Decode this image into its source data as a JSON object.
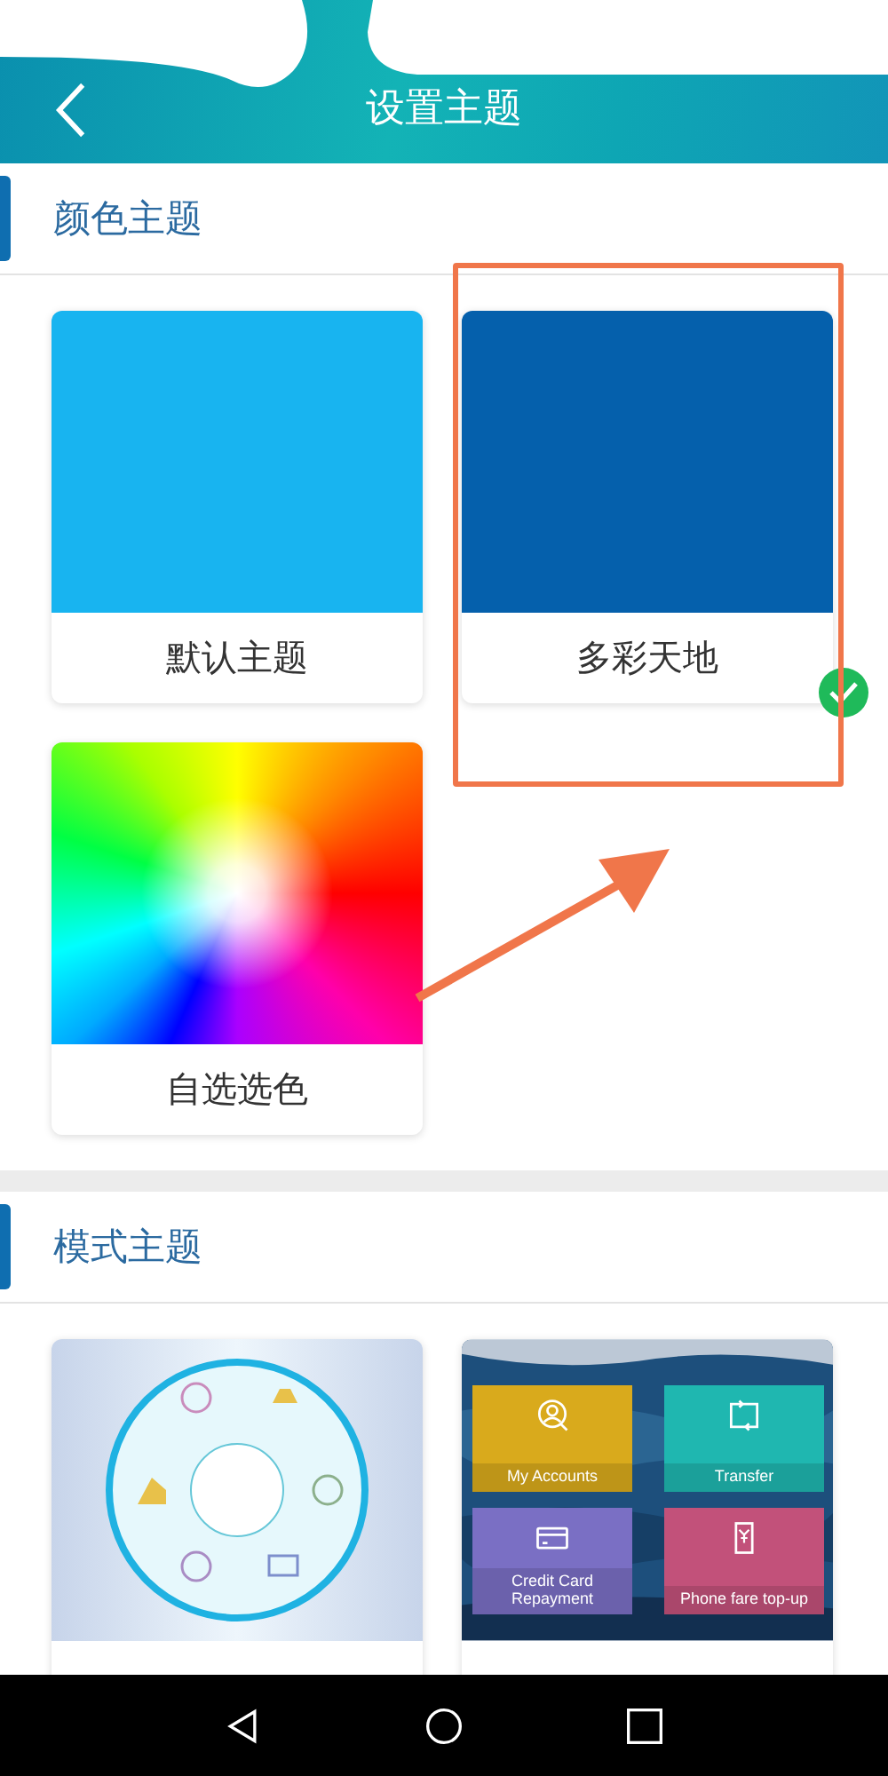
{
  "header": {
    "title": "设置主题"
  },
  "color_section": {
    "title": "颜色主题",
    "themes": [
      {
        "label": "默认主题",
        "kind": "solid",
        "color": "#18b4f0",
        "selected": false
      },
      {
        "label": "多彩天地",
        "kind": "solid",
        "color": "#0560ac",
        "selected": true
      },
      {
        "label": "自选选色",
        "kind": "spectrum",
        "selected": false
      }
    ]
  },
  "mode_section": {
    "title": "模式主题",
    "themes": [
      {
        "kind": "dial"
      },
      {
        "kind": "tiles",
        "tiles": [
          {
            "label": "My Accounts",
            "color": "#d9aa1c"
          },
          {
            "label": "Transfer",
            "color": "#1fb7b0"
          },
          {
            "label": "Credit Card Repayment",
            "color": "#7a6fc4"
          },
          {
            "label": "Phone fare top-up",
            "color": "#c2517a"
          }
        ]
      }
    ]
  }
}
